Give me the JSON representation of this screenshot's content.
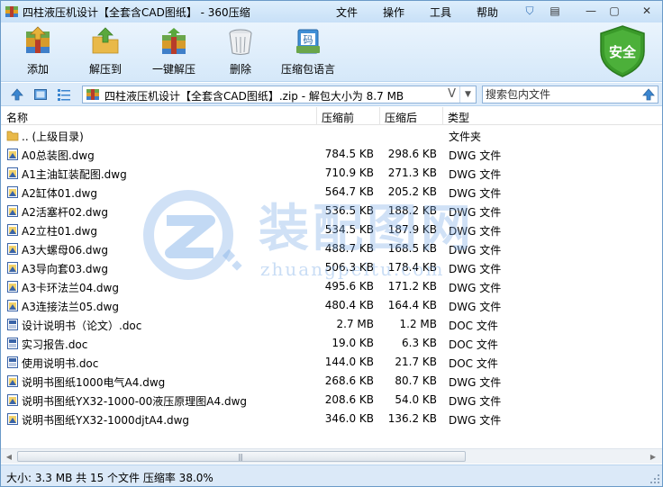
{
  "window": {
    "title": "四柱液压机设计【全套含CAD图纸】 - 360压缩",
    "menus": [
      "文件",
      "操作",
      "工具",
      "帮助"
    ],
    "controls": {
      "shirt": "⛉",
      "menu": "▤",
      "minimize": "—",
      "maximize": "▢",
      "close": "✕"
    }
  },
  "toolbar": {
    "buttons": [
      {
        "label": "添加",
        "icon": "add-archive-icon"
      },
      {
        "label": "解压到",
        "icon": "extract-to-icon"
      },
      {
        "label": "一键解压",
        "icon": "one-click-extract-icon"
      },
      {
        "label": "删除",
        "icon": "trash-icon"
      },
      {
        "label": "压缩包语言",
        "icon": "archive-language-icon",
        "badge": "码"
      }
    ],
    "safe_badge": "安全"
  },
  "addressbar": {
    "path": "四柱液压机设计【全套含CAD图纸】.zip - 解包大小为 8.7 MB",
    "v_glyph": "V",
    "search_placeholder": "搜索包内文件"
  },
  "columns": {
    "name": "名称",
    "compressed_before": "压缩前",
    "compressed_after": "压缩后",
    "type": "类型"
  },
  "files": [
    {
      "name": ".. (上级目录)",
      "before": "",
      "after": "",
      "type": "文件夹",
      "kind": "folder"
    },
    {
      "name": "A0总装图.dwg",
      "before": "784.5 KB",
      "after": "298.6 KB",
      "type": "DWG 文件",
      "kind": "dwg"
    },
    {
      "name": "A1主油缸装配图.dwg",
      "before": "710.9 KB",
      "after": "271.3 KB",
      "type": "DWG 文件",
      "kind": "dwg"
    },
    {
      "name": "A2缸体01.dwg",
      "before": "564.7 KB",
      "after": "205.2 KB",
      "type": "DWG 文件",
      "kind": "dwg"
    },
    {
      "name": "A2活塞杆02.dwg",
      "before": "536.5 KB",
      "after": "188.2 KB",
      "type": "DWG 文件",
      "kind": "dwg"
    },
    {
      "name": "A2立柱01.dwg",
      "before": "534.5 KB",
      "after": "187.9 KB",
      "type": "DWG 文件",
      "kind": "dwg"
    },
    {
      "name": "A3大螺母06.dwg",
      "before": "488.7 KB",
      "after": "168.5 KB",
      "type": "DWG 文件",
      "kind": "dwg"
    },
    {
      "name": "A3导向套03.dwg",
      "before": "506.3 KB",
      "after": "178.4 KB",
      "type": "DWG 文件",
      "kind": "dwg"
    },
    {
      "name": "A3卡环法兰04.dwg",
      "before": "495.6 KB",
      "after": "171.2 KB",
      "type": "DWG 文件",
      "kind": "dwg"
    },
    {
      "name": "A3连接法兰05.dwg",
      "before": "480.4 KB",
      "after": "164.4 KB",
      "type": "DWG 文件",
      "kind": "dwg"
    },
    {
      "name": "设计说明书（论文）.doc",
      "before": "2.7 MB",
      "after": "1.2 MB",
      "type": "DOC 文件",
      "kind": "doc"
    },
    {
      "name": "实习报告.doc",
      "before": "19.0 KB",
      "after": "6.3 KB",
      "type": "DOC 文件",
      "kind": "doc"
    },
    {
      "name": "使用说明书.doc",
      "before": "144.0 KB",
      "after": "21.7 KB",
      "type": "DOC 文件",
      "kind": "doc"
    },
    {
      "name": "说明书图纸1000电气A4.dwg",
      "before": "268.6 KB",
      "after": "80.7 KB",
      "type": "DWG 文件",
      "kind": "dwg"
    },
    {
      "name": "说明书图纸YX32-1000-00液压原理图A4.dwg",
      "before": "208.6 KB",
      "after": "54.0 KB",
      "type": "DWG 文件",
      "kind": "dwg"
    },
    {
      "name": "说明书图纸YX32-1000djtA4.dwg",
      "before": "346.0 KB",
      "after": "136.2 KB",
      "type": "DWG 文件",
      "kind": "dwg"
    }
  ],
  "watermark": {
    "title": "装配图网",
    "url": "zhuangpeitu.com"
  },
  "statusbar": {
    "text": "大小: 3.3 MB 共 15 个文件 压缩率 38.0%"
  },
  "colors": {
    "accent": "#2f6db5",
    "shield_green": "#3a9a2a",
    "titlebar": "#cfe4f8"
  }
}
